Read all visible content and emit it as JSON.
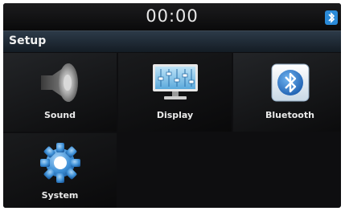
{
  "status_bar": {
    "clock": "00:00",
    "bluetooth_icon": "bluetooth-status-icon"
  },
  "header": {
    "title": "Setup"
  },
  "menu": {
    "items": [
      {
        "label": "Sound",
        "icon": "speaker-icon"
      },
      {
        "label": "Display",
        "icon": "monitor-equalizer-icon"
      },
      {
        "label": "Bluetooth",
        "icon": "bluetooth-icon"
      },
      {
        "label": "System",
        "icon": "gear-icon"
      }
    ]
  },
  "colors": {
    "background": "#0e0e10",
    "title_bar": "#2c3a48",
    "text": "#eaeaea",
    "bluetooth_accent": "#2f7fd8"
  }
}
